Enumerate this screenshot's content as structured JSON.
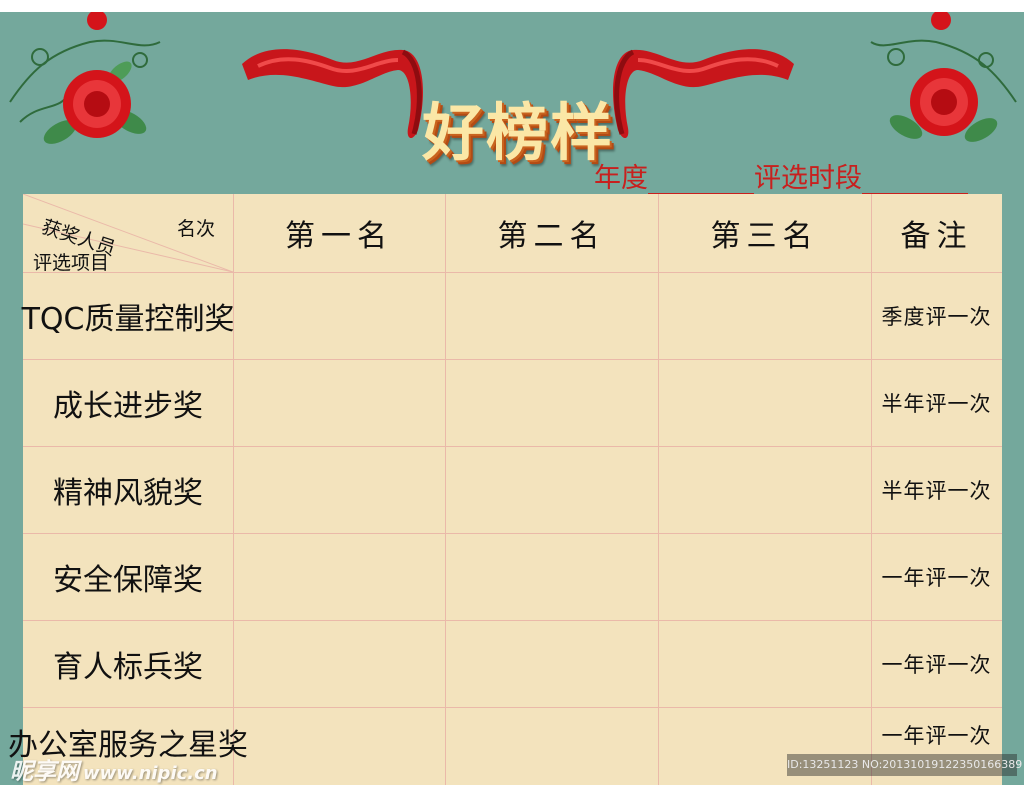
{
  "title": "好榜样",
  "period": {
    "year_label": "年度",
    "period_label": "评选时段"
  },
  "table": {
    "corner": {
      "persons": "获奖人员",
      "rank": "名次",
      "items": "评选项目"
    },
    "headers": [
      "第一名",
      "第二名",
      "第三名",
      "备注"
    ],
    "rows": [
      {
        "award": "TQC质量控制奖",
        "note": "季度评一次"
      },
      {
        "award": "成长进步奖",
        "note": "半年评一次"
      },
      {
        "award": "精神风貌奖",
        "note": "半年评一次"
      },
      {
        "award": "安全保障奖",
        "note": "一年评一次"
      },
      {
        "award": "育人标兵奖",
        "note": "一年评一次"
      },
      {
        "award": "办公室服务之星奖",
        "note": "一年评一次"
      }
    ]
  },
  "watermark": {
    "site": "昵享网",
    "url": "www.nipic.cn",
    "id": "ID:13251123 NO:20131019122350166389"
  },
  "colors": {
    "background": "#74a89c",
    "table": "#f3e3bd",
    "accent_red": "#c8201e",
    "grid": "#eab9a9"
  }
}
